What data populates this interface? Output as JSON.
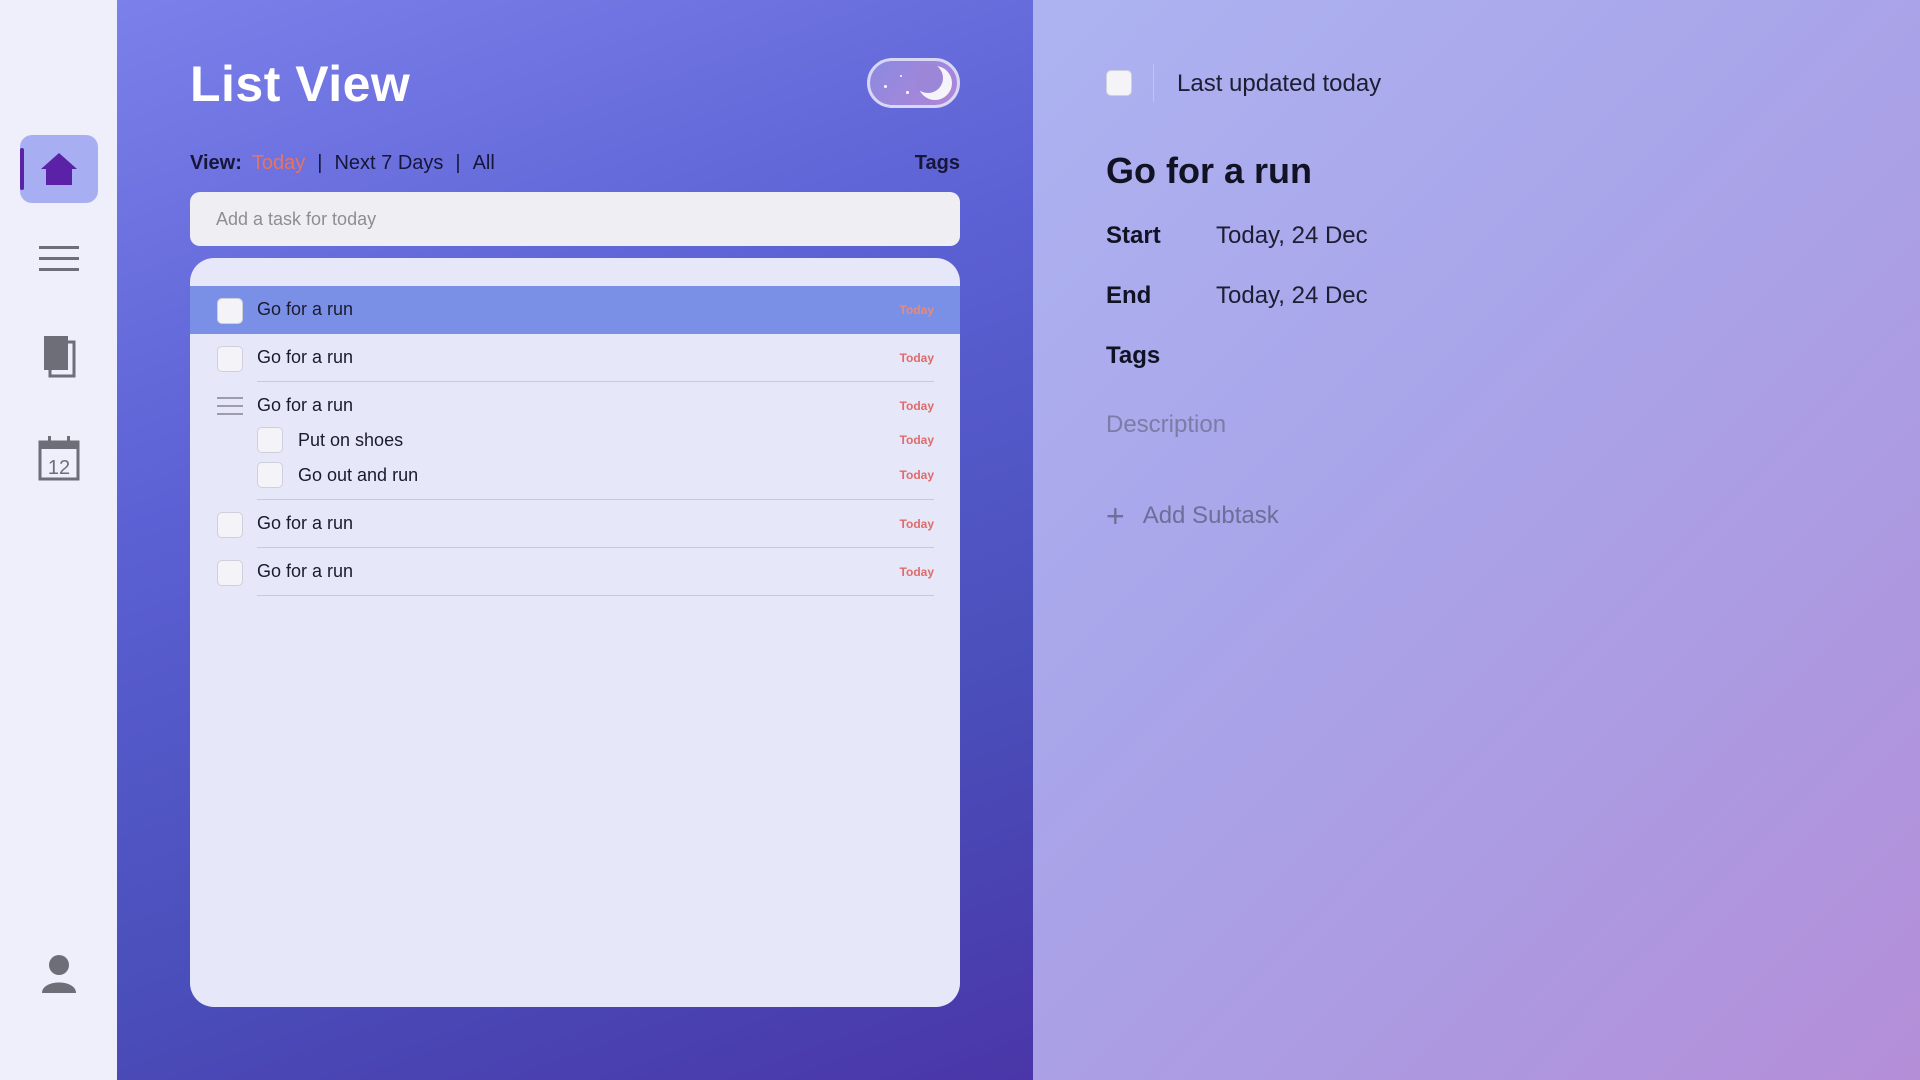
{
  "nav": {
    "items": [
      {
        "name": "home",
        "icon": "home-icon"
      },
      {
        "name": "menu",
        "icon": "menu-icon"
      },
      {
        "name": "notes",
        "icon": "notes-icon"
      },
      {
        "name": "calendar",
        "icon": "calendar-icon",
        "label": "12"
      },
      {
        "name": "profile",
        "icon": "user-icon"
      }
    ],
    "active": "home"
  },
  "list": {
    "title": "List View",
    "view_label": "View:",
    "views": [
      "Today",
      "Next 7 Days",
      "All"
    ],
    "active_view": "Today",
    "tags_label": "Tags",
    "add_placeholder": "Add a task for today",
    "tasks": [
      {
        "title": "Go for a run",
        "due": "Today",
        "selected": true
      },
      {
        "title": "Go for a run",
        "due": "Today"
      },
      {
        "title": "Go for a run",
        "due": "Today",
        "subtasks": [
          {
            "title": "Put on shoes",
            "due": "Today"
          },
          {
            "title": "Go out and run",
            "due": "Today"
          }
        ]
      },
      {
        "title": "Go for a run",
        "due": "Today"
      },
      {
        "title": "Go for a run",
        "due": "Today"
      }
    ]
  },
  "detail": {
    "updated": "Last updated today",
    "title": "Go for a run",
    "start_label": "Start",
    "start_value": "Today, 24 Dec",
    "end_label": "End",
    "end_value": "Today, 24 Dec",
    "tags_label": "Tags",
    "description_placeholder": "Description",
    "add_subtask_label": "Add Subtask"
  },
  "colors": {
    "accent": "#e8735d",
    "rail_active": "#a7aff2",
    "home_icon": "#5b22a8",
    "selected_row": "#7a90e6"
  }
}
